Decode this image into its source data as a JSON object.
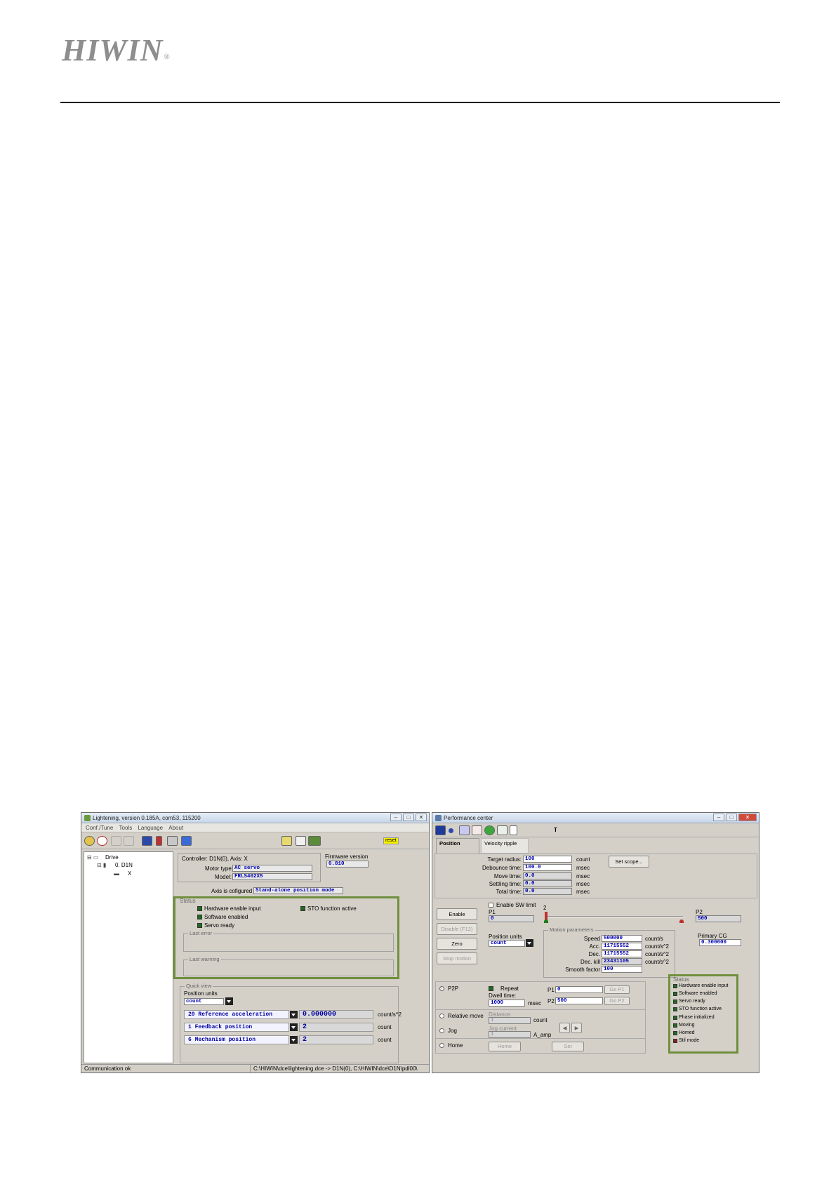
{
  "header": {
    "logo": "HIWIN",
    "registered": "®"
  },
  "left_window": {
    "title": "Lightening, version 0.185A, com53, 115200",
    "menu": [
      "Conf./Tune",
      "Tools",
      "Language",
      "About"
    ],
    "reset": "reset",
    "tree": {
      "root": "Drive",
      "drive": "0. D1N",
      "axis": "X"
    },
    "controller_line": "Controller: D1N(0), Axis: X",
    "motor_type_label": "Motor type:",
    "motor_type": "AC servo",
    "model_label": "Model:",
    "model": "FRLS402X5",
    "firmware_label": "Firmware version",
    "firmware": "0.810",
    "config_label": "Axis is cofigured to:",
    "config_value": "Stand-alone position mode",
    "status_title": "Status",
    "status_items": [
      "Hardware enable input",
      "Software enabled",
      "Servo ready",
      "STO function active"
    ],
    "last_error": "Last error",
    "last_warning": "Last warning",
    "quick_view": "Quick view",
    "position_units_label": "Position units",
    "position_units": "count",
    "quick_rows": [
      {
        "name": "20 Reference acceleration",
        "value": "0.000000",
        "unit": "count/s^2"
      },
      {
        "name": "1 Feedback position",
        "value": "2",
        "unit": "count"
      },
      {
        "name": "6 Mechanism position",
        "value": "2",
        "unit": "count"
      }
    ],
    "status_bar": "Communication ok",
    "status_path": "C:\\HIWIN\\dce\\lightening.dce -> D1N(0), C:\\HIWIN\\dce\\D1N\\pdl00\\"
  },
  "right_window": {
    "title": "Performance center",
    "t_label": "T",
    "tabs": [
      "Position",
      "Velocity ripple"
    ],
    "target_radius_label": "Target radius:",
    "target_radius": "100",
    "target_radius_unit": "count",
    "debounce_label": "Debounce time:",
    "debounce": "100.0",
    "debounce_unit": "msec",
    "move_time_label": "Move time:",
    "move_time": "0.0",
    "move_time_unit": "msec",
    "settling_label": "Settling time:",
    "settling": "0.0",
    "settling_unit": "msec",
    "total_label": "Total time:",
    "total": "0.0",
    "total_unit": "msec",
    "set_scope": "Set scope...",
    "enable_sw_limit": "Enable SW limit",
    "btn_enable": "Enable",
    "btn_disable": "Disable (F12)",
    "btn_zero": "Zero",
    "btn_stop": "Stop motion",
    "p1_label": "P1",
    "p1": "0",
    "p2_label": "P2",
    "p2": "500",
    "slider_mark": "2",
    "position_units_label": "Position units",
    "position_units": "count",
    "motion_params": "Motion parameters",
    "speed_label": "Speed",
    "speed": "500000",
    "speed_unit": "count/s",
    "acc_label": "Acc.",
    "acc": "11715552",
    "acc_unit": "count/s^2",
    "dec_label": "Dec.",
    "dec": "11715552",
    "dec_unit": "count/s^2",
    "deckill_label": "Dec. kill",
    "deckill": "23431105",
    "deckill_unit": "count/s^2",
    "smooth_label": "Smooth factor",
    "smooth": "100",
    "primary_cg_label": "Primary CG",
    "primary_cg": "0.300000",
    "p2p": "P2P",
    "repeat": "Repeat",
    "dwell_label": "Dwell time:",
    "dwell": "1000",
    "dwell_unit": "msec",
    "p2p_p1_label": "P1",
    "p2p_p1": "0",
    "p2p_p2_label": "P2",
    "p2p_p2": "500",
    "go_p1": "Go P1",
    "go_p2": "Go P2",
    "relative_move": "Relative move",
    "distance_label": "Distance",
    "distance": "1",
    "distance_unit": "count",
    "jog": "Jog",
    "jog_current_label": "Jog current",
    "jog_current": "1",
    "jog_unit": "A_amp",
    "home": "Home",
    "home_btn": "Home",
    "set_btn": "Set",
    "status_title": "Status",
    "status_items": [
      "Hardware enable input",
      "Software enabled",
      "Servo ready",
      "STO function active",
      "Phase initialized",
      "Moving",
      "Homed",
      "Stil mode"
    ]
  }
}
